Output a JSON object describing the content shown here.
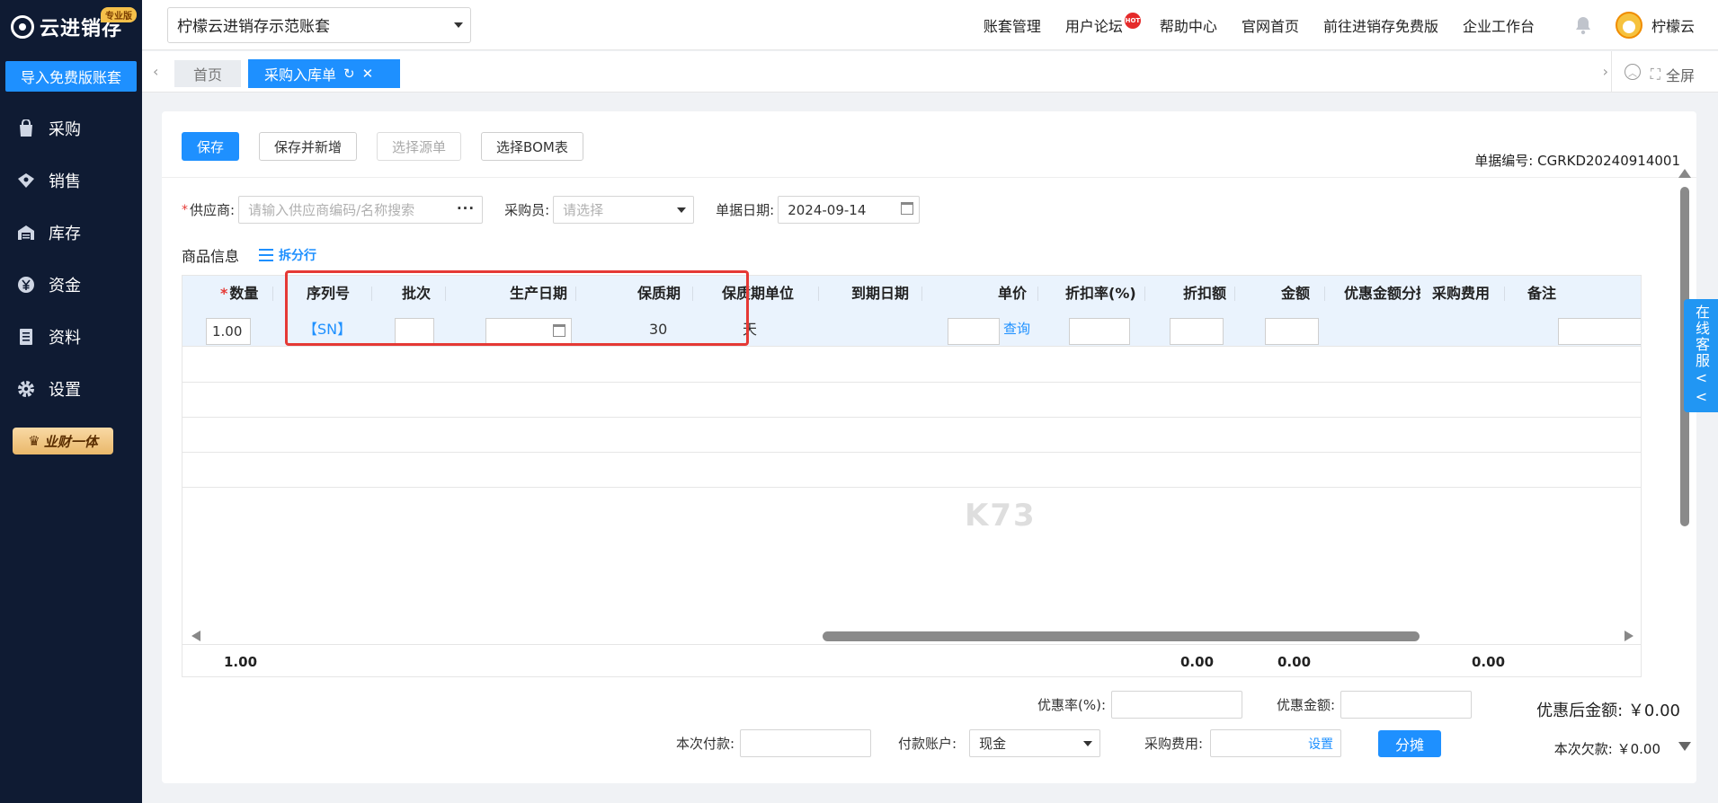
{
  "brand": {
    "name": "云进销存",
    "edition": "专业版"
  },
  "sidebar": {
    "import_label": "导入免费版账套",
    "items": [
      {
        "label": "采购",
        "icon": "bag-icon"
      },
      {
        "label": "销售",
        "icon": "sales-icon"
      },
      {
        "label": "库存",
        "icon": "warehouse-icon"
      },
      {
        "label": "资金",
        "icon": "yen-icon"
      },
      {
        "label": "资料",
        "icon": "document-icon"
      },
      {
        "label": "设置",
        "icon": "gear-icon"
      }
    ],
    "yecai_label": "业财一体"
  },
  "header": {
    "account": "柠檬云进销存示范账套",
    "links": [
      "账套管理",
      "用户论坛",
      "帮助中心",
      "官网首页",
      "前往进销存免费版",
      "企业工作台"
    ],
    "hot_badge": "HOT",
    "user_name": "柠檬云"
  },
  "tabs": {
    "home": "首页",
    "active": "采购入库单",
    "fullscreen": "全屏"
  },
  "toolbar": {
    "save": "保存",
    "save_new": "保存并新增",
    "select_source": "选择源单",
    "select_bom": "选择BOM表"
  },
  "doc": {
    "label": "单据编号:",
    "number": "CGRKD20240914001"
  },
  "form": {
    "supplier_label": "供应商:",
    "supplier_placeholder": "请输入供应商编码/名称搜索",
    "buyer_label": "采购员:",
    "buyer_placeholder": "请选择",
    "date_label": "单据日期:",
    "date_value": "2024-09-14"
  },
  "section": {
    "title": "商品信息",
    "split_label": "拆分行"
  },
  "table": {
    "columns": [
      "数量",
      "序列号",
      "批次",
      "生产日期",
      "保质期",
      "保质期单位",
      "到期日期",
      "单价",
      "折扣率(%)",
      "折扣额",
      "金额",
      "优惠金额分摊",
      "采购费用",
      "备注"
    ],
    "row": {
      "qty": "1.00",
      "serial": "【SN】",
      "shelf_life": "30",
      "shelf_unit": "天",
      "price_query": "查询"
    },
    "totals": {
      "qty": "1.00",
      "discount_amount": "0.00",
      "amount": "0.00",
      "purchase_fee": "0.00"
    }
  },
  "bottom": {
    "discount_rate_label": "优惠率(%):",
    "discount_amount_label": "优惠金额:",
    "after_discount_label": "优惠后金额:",
    "after_discount_value": "￥0.00",
    "payment_label": "本次付款:",
    "account_label": "付款账户:",
    "account_value": "现金",
    "fee_label": "采购费用:",
    "fee_setting": "设置",
    "allocate_button": "分摊",
    "debt_label": "本次欠款:",
    "debt_value": "￥0.00"
  },
  "service": {
    "label": "在线客服<<"
  },
  "colors": {
    "primary": "#1e90ff",
    "sidebar": "#0f1b33",
    "highlight": "#e53935"
  }
}
